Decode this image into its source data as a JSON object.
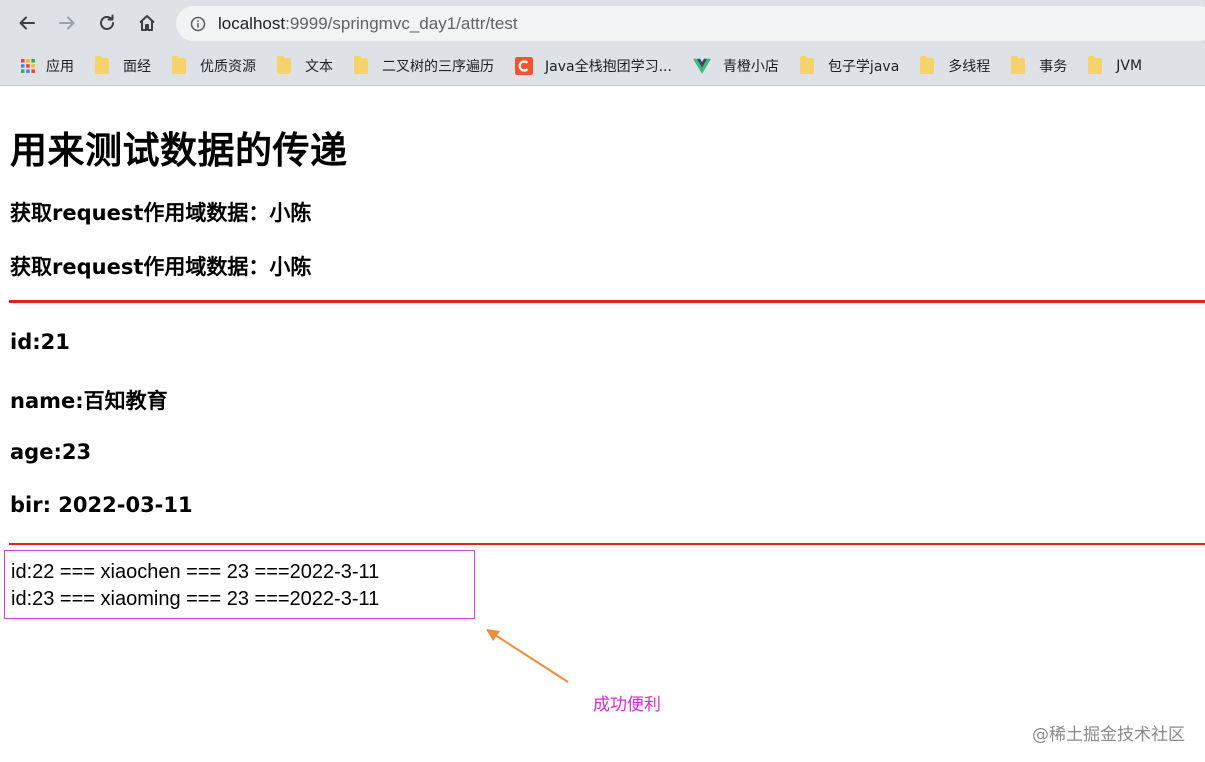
{
  "browser": {
    "url_host": "localhost",
    "url_rest": ":9999/springmvc_day1/attr/test",
    "bookmarks": [
      {
        "label": "应用",
        "icon": "apps-grid-icon"
      },
      {
        "label": "面经",
        "icon": "folder-icon"
      },
      {
        "label": "优质资源",
        "icon": "folder-icon"
      },
      {
        "label": "文本",
        "icon": "folder-icon"
      },
      {
        "label": "二叉树的三序遍历",
        "icon": "folder-icon"
      },
      {
        "label": "Java全栈抱团学习...",
        "icon": "csdn-icon"
      },
      {
        "label": "青橙小店",
        "icon": "vue-icon"
      },
      {
        "label": "包子学java",
        "icon": "folder-icon"
      },
      {
        "label": "多线程",
        "icon": "folder-icon"
      },
      {
        "label": "事务",
        "icon": "folder-icon"
      },
      {
        "label": "JVM",
        "icon": "folder-icon"
      }
    ]
  },
  "page": {
    "title": "用来测试数据的传递",
    "request_line_1": "获取request作用域数据：小陈",
    "request_line_2": "获取request作用域数据：小陈",
    "id": "id:21",
    "name": "name:百知教育",
    "age": "age:23",
    "bir": "bir: 2022-03-11",
    "list": [
      "id:22 === xiaochen === 23 ===2022-3-11",
      "id:23 === xiaoming === 23 ===2022-3-11"
    ],
    "annotation": "成功便利",
    "watermark": "@稀土掘金技术社区"
  },
  "colors": {
    "divider": "#e0241c",
    "box_border": "#c844e0",
    "annotation": "#d62ad6",
    "arrow": "#f08a3c"
  }
}
